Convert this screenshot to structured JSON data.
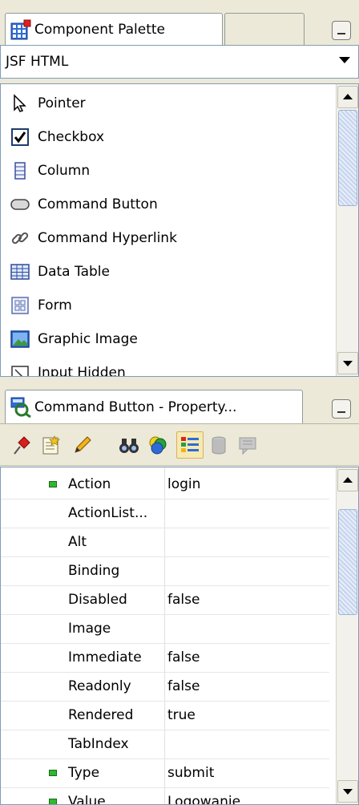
{
  "palette": {
    "tab_title": "Component Palette",
    "library": "JSF HTML",
    "items": [
      {
        "label": "Pointer",
        "icon": "pointer-icon"
      },
      {
        "label": "Checkbox",
        "icon": "checkbox-icon"
      },
      {
        "label": "Column",
        "icon": "column-icon"
      },
      {
        "label": "Command Button",
        "icon": "command-button-icon"
      },
      {
        "label": "Command Hyperlink",
        "icon": "command-hyperlink-icon"
      },
      {
        "label": "Data Table",
        "icon": "data-table-icon"
      },
      {
        "label": "Form",
        "icon": "form-icon"
      },
      {
        "label": "Graphic Image",
        "icon": "graphic-image-icon"
      },
      {
        "label": "Input Hidden",
        "icon": "input-hidden-icon"
      }
    ]
  },
  "inspector": {
    "tab_title": "Command Button - Property...",
    "toolbar": [
      "pin-icon",
      "edit-properties-icon",
      "pencil-icon",
      "binoculars-icon",
      "color-spheres-icon",
      "categorized-view-icon",
      "database-icon",
      "comment-icon"
    ],
    "properties": [
      {
        "name": "Action",
        "value": "login",
        "marked": true
      },
      {
        "name": "ActionList...",
        "value": "",
        "marked": false
      },
      {
        "name": "Alt",
        "value": "",
        "marked": false
      },
      {
        "name": "Binding",
        "value": "",
        "marked": false
      },
      {
        "name": "Disabled",
        "value": "false",
        "marked": false
      },
      {
        "name": "Image",
        "value": "",
        "marked": false
      },
      {
        "name": "Immediate",
        "value": "false",
        "marked": false
      },
      {
        "name": "Readonly",
        "value": "false",
        "marked": false
      },
      {
        "name": "Rendered",
        "value": "true",
        "marked": false
      },
      {
        "name": "TabIndex",
        "value": "",
        "marked": false
      },
      {
        "name": "Type",
        "value": "submit",
        "marked": true
      },
      {
        "name": "Value",
        "value": "Logowanie",
        "marked": true
      }
    ]
  },
  "colors": {
    "marker": "#2eb82e",
    "selection": "#f6e9b2",
    "border": "#7f9db9"
  }
}
